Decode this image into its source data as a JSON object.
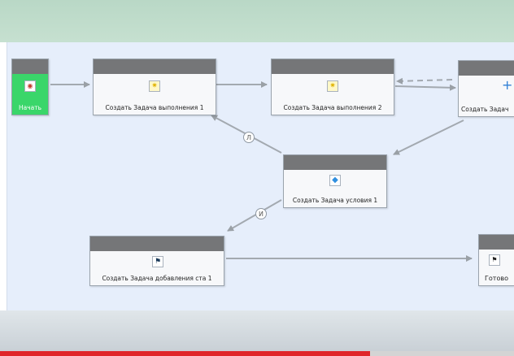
{
  "nodes": {
    "start": {
      "label": "Начать"
    },
    "task1": {
      "label": "Создать Задача выполнения 1"
    },
    "task2": {
      "label": "Создать Задача выполнения 2"
    },
    "task3": {
      "label": "Создать Задач"
    },
    "condition": {
      "label": "Создать Задача условия 1"
    },
    "add": {
      "label": "Создать Задача добавления ста 1"
    },
    "done": {
      "label": "Готово"
    }
  },
  "conditions": {
    "false_label": "Л",
    "true_label": "И"
  },
  "icons": {
    "start": "eye-icon",
    "task1": "sparkle-icon",
    "task2": "sparkle-icon",
    "task3": "plus-icon",
    "condition": "diamond-icon",
    "add": "flag-icon",
    "done": "checkered-flags-icon"
  },
  "video": {
    "progress": 0.72
  },
  "colors": {
    "start_fill": "#3ad66a",
    "header_gray": "#757678",
    "canvas_bg": "#e6eefb",
    "progress_red": "#e0262a"
  }
}
